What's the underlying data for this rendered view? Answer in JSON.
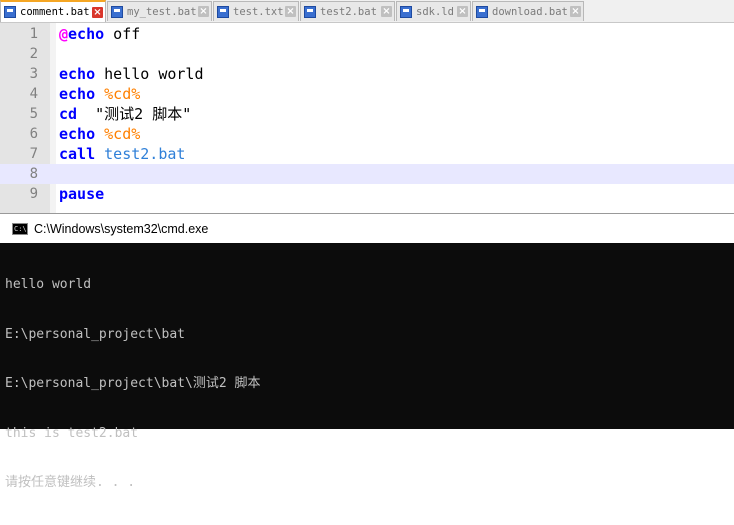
{
  "tabs": [
    {
      "label": "comment.bat",
      "active": true
    },
    {
      "label": "my_test.bat",
      "active": false
    },
    {
      "label": "test.txt",
      "active": false
    },
    {
      "label": "test2.bat",
      "active": false
    },
    {
      "label": "sdk.ld",
      "active": false
    },
    {
      "label": "download.bat",
      "active": false
    }
  ],
  "close_glyph": "×",
  "editor": {
    "current_line": 8,
    "lines": [
      {
        "n": "1",
        "segments": [
          {
            "t": "@",
            "c": "at"
          },
          {
            "t": "echo",
            "c": "kw"
          },
          {
            "t": " off",
            "c": "txt"
          }
        ]
      },
      {
        "n": "2",
        "segments": []
      },
      {
        "n": "3",
        "segments": [
          {
            "t": "echo",
            "c": "kw"
          },
          {
            "t": " hello world",
            "c": "txt"
          }
        ]
      },
      {
        "n": "4",
        "segments": [
          {
            "t": "echo",
            "c": "kw"
          },
          {
            "t": " ",
            "c": "txt"
          },
          {
            "t": "%cd%",
            "c": "var"
          }
        ]
      },
      {
        "n": "5",
        "segments": [
          {
            "t": "cd",
            "c": "kw"
          },
          {
            "t": "  \"测试2 脚本\"",
            "c": "txt"
          }
        ]
      },
      {
        "n": "6",
        "segments": [
          {
            "t": "echo",
            "c": "kw"
          },
          {
            "t": " ",
            "c": "txt"
          },
          {
            "t": "%cd%",
            "c": "var"
          }
        ]
      },
      {
        "n": "7",
        "segments": [
          {
            "t": "call",
            "c": "kw"
          },
          {
            "t": " ",
            "c": "txt"
          },
          {
            "t": "test2.bat",
            "c": "fn"
          }
        ]
      },
      {
        "n": "8",
        "segments": []
      },
      {
        "n": "9",
        "segments": [
          {
            "t": "pause",
            "c": "kw"
          }
        ]
      }
    ]
  },
  "console": {
    "title": "C:\\Windows\\system32\\cmd.exe",
    "icon_text": "C:\\",
    "output": [
      "hello world",
      "E:\\personal_project\\bat",
      "E:\\personal_project\\bat\\测试2 脚本",
      "this is test2.bat",
      "请按任意键继续. . ."
    ]
  },
  "colors": {
    "keyword": "#0000ff",
    "at_sign": "#ff00ff",
    "variable": "#ff8000",
    "filename": "#3080d8",
    "current_line_bg": "#e8e8ff",
    "active_tab_accent": "#f5a623",
    "console_bg": "#0c0c0c",
    "console_text": "#c0c0c0"
  },
  "icons": {
    "tab_file": "save-disk-icon",
    "tab_close": "close-icon",
    "console": "cmd-icon"
  }
}
